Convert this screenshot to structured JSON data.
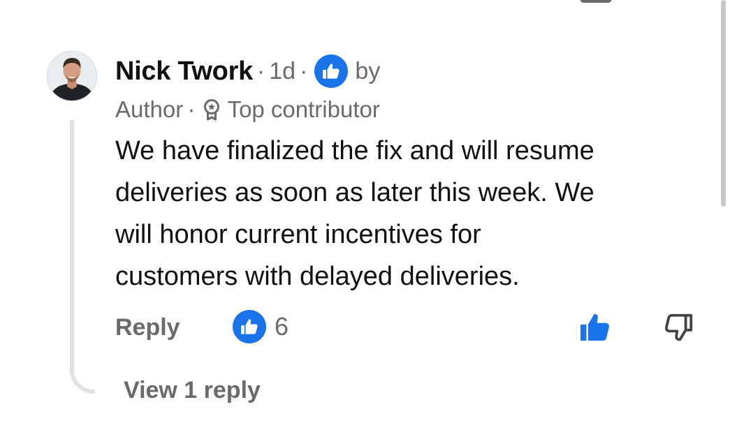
{
  "colors": {
    "accent": "#1a73e8",
    "text_primary": "#111111",
    "text_secondary": "#6a6a6a",
    "thread_line": "#e2e2e2"
  },
  "comment": {
    "author": "Nick Twork",
    "separator": "·",
    "time": "1d",
    "liked_by_icon": "thumbs-up-icon",
    "liked_by_label": "by",
    "role": "Author",
    "badge_icon": "award-ribbon-icon",
    "badge_label": "Top contributor",
    "body_lines": [
      "We have finalized the fix and will resume",
      "deliveries as soon as later this week. We",
      "will honor current incentives for",
      "customers with delayed deliveries."
    ]
  },
  "actions": {
    "reply_label": "Reply",
    "reaction_icon": "thumbs-up-icon",
    "reaction_count": "6",
    "like_icon": "thumbs-up-filled-icon",
    "dislike_icon": "thumbs-down-outline-icon"
  },
  "replies": {
    "view_label": "View 1 reply"
  }
}
